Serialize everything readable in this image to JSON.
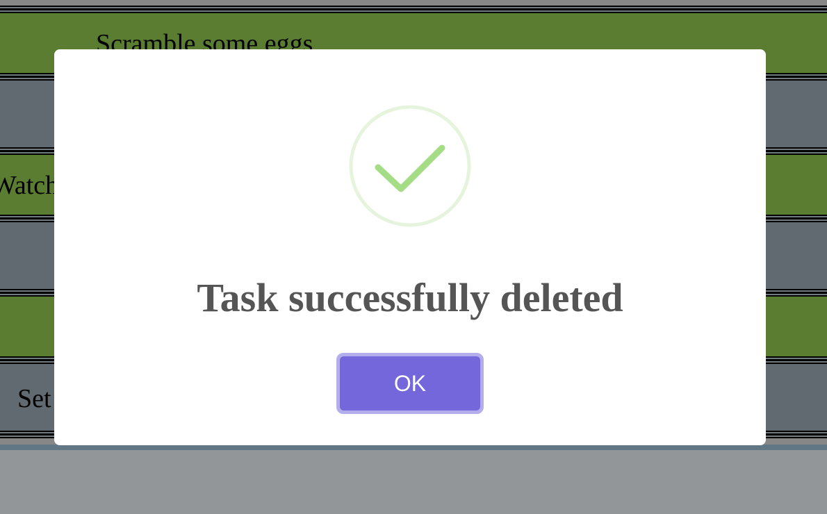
{
  "tasks": [
    {
      "text": "Scramble some eggs",
      "color": "green"
    },
    {
      "text": "",
      "color": "gray"
    },
    {
      "text": "Watch",
      "color": "green"
    },
    {
      "text": "",
      "color": "gray"
    },
    {
      "text": "",
      "color": "green"
    },
    {
      "text": "Set",
      "color": "gray"
    }
  ],
  "dialog": {
    "icon": "success-checkmark-icon",
    "title": "Task successfully deleted",
    "ok_label": "OK"
  },
  "colors": {
    "row_green": "#86b84b",
    "row_gray": "#8f9ca6",
    "check_stroke": "#a5dc86",
    "check_ring": "#e6f4de",
    "button": "#7367db",
    "button_ring": "#b3adeb",
    "title_text": "#555555"
  }
}
